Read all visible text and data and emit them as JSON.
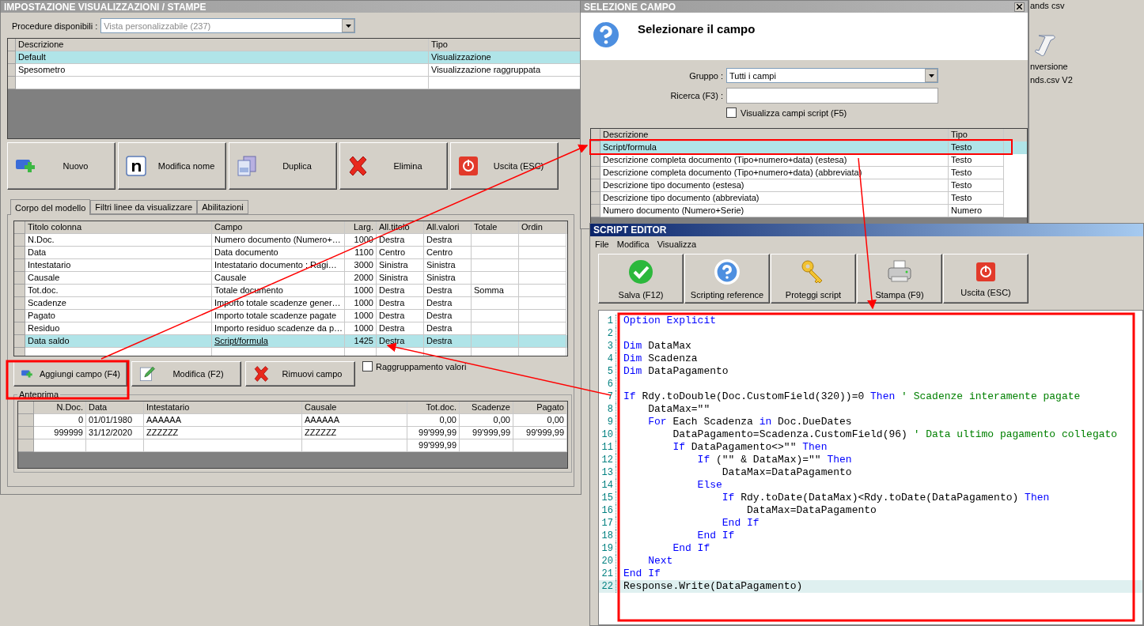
{
  "main_window": {
    "title": "IMPOSTAZIONE VISUALIZZAZIONI / STAMPE",
    "procedure": {
      "label": "Procedure disponibili :",
      "value": "Vista personalizzabile (237)",
      "disabled": true
    },
    "views_table": {
      "columns": [
        "Descrizione",
        "Tipo"
      ],
      "rows": [
        {
          "cells": [
            "Default",
            "Visualizzazione"
          ],
          "selected": true
        },
        {
          "cells": [
            "Spesometro",
            "Visualizzazione raggruppata"
          ],
          "selected": false
        }
      ]
    },
    "toolbar": [
      {
        "label": "Nuovo",
        "kind": "new"
      },
      {
        "label": "Modifica nome",
        "kind": "rename"
      },
      {
        "label": "Duplica",
        "kind": "duplicate"
      },
      {
        "label": "Elimina",
        "kind": "delete"
      },
      {
        "label": "Uscita (ESC)",
        "kind": "exit"
      }
    ],
    "tabs": [
      {
        "label": "Corpo del modello",
        "selected": true
      },
      {
        "label": "Filtri linee da visualizzare",
        "selected": false
      },
      {
        "label": "Abilitazioni",
        "selected": false
      }
    ],
    "fields_table": {
      "columns": [
        "Titolo colonna",
        "Campo",
        "Larg.",
        "All.titolo",
        "All.valori",
        "Totale",
        "Ordin"
      ],
      "rows": [
        {
          "cells": [
            "N.Doc.",
            "Numero documento (Numero+…",
            "1000",
            "Destra",
            "Destra",
            null,
            null
          ],
          "selected": false
        },
        {
          "cells": [
            "Data",
            "Data documento",
            "1100",
            "Centro",
            "Centro",
            null,
            null
          ],
          "selected": false
        },
        {
          "cells": [
            "Intestatario",
            "Intestatario documento : Ragi…",
            "3000",
            "Sinistra",
            "Sinistra",
            null,
            null
          ],
          "selected": false
        },
        {
          "cells": [
            "Causale",
            "Causale",
            "2000",
            "Sinistra",
            "Sinistra",
            null,
            null
          ],
          "selected": false
        },
        {
          "cells": [
            "Tot.doc.",
            "Totale documento",
            "1000",
            "Destra",
            "Destra",
            "Somma",
            null
          ],
          "selected": false
        },
        {
          "cells": [
            "Scadenze",
            "Importo totale scadenze gener…",
            "1000",
            "Destra",
            "Destra",
            null,
            null
          ],
          "selected": false
        },
        {
          "cells": [
            "Pagato",
            "Importo totale scadenze pagate",
            "1000",
            "Destra",
            "Destra",
            null,
            null
          ],
          "selected": false
        },
        {
          "cells": [
            "Residuo",
            "Importo residuo scadenze da p…",
            "1000",
            "Destra",
            "Destra",
            null,
            null
          ],
          "selected": false
        },
        {
          "cells": [
            "Data saldo",
            "Script/formula",
            "1425",
            "Destra",
            "Destra",
            null,
            null
          ],
          "selected": true
        }
      ]
    },
    "field_buttons": [
      {
        "label": "Aggiungi campo (F4)",
        "kind": "add"
      },
      {
        "label": "Modifica (F2)",
        "kind": "edit"
      },
      {
        "label": "Rimuovi campo",
        "kind": "delete"
      }
    ],
    "grouping": {
      "label": "Raggruppamento valori",
      "checked": false
    },
    "preview": {
      "title": "Anteprima",
      "columns": [
        "N.Doc.",
        "Data",
        "Intestatario",
        "Causale",
        "Tot.doc.",
        "Scadenze",
        "Pagato"
      ],
      "rows": [
        [
          "0",
          "01/01/1980",
          "AAAAAA",
          "AAAAAA",
          "0,00",
          "0,00",
          "0,00"
        ],
        [
          "999999",
          "31/12/2020",
          "ZZZZZZ",
          "ZZZZZZ",
          "99'999,99",
          "99'999,99",
          "99'999,99"
        ],
        [
          null,
          null,
          null,
          null,
          "99'999,99",
          null,
          null
        ]
      ]
    }
  },
  "field_dialog": {
    "title": "SELEZIONE CAMPO",
    "heading": "Selezionare il campo",
    "group": {
      "label": "Gruppo :",
      "value": "Tutti i campi"
    },
    "search": {
      "label": "Ricerca (F3) :"
    },
    "script_fields": {
      "label": "Visualizza campi script (F5)",
      "checked": false
    },
    "table": {
      "columns": [
        "Descrizione",
        "Tipo"
      ],
      "rows": [
        {
          "cells": [
            "Script/formula",
            "Testo"
          ],
          "selected": true
        },
        {
          "cells": [
            "Descrizione completa documento (Tipo+numero+data) (estesa)",
            "Testo"
          ],
          "selected": false
        },
        {
          "cells": [
            "Descrizione completa documento (Tipo+numero+data) (abbreviata)",
            "Testo"
          ],
          "selected": false
        },
        {
          "cells": [
            "Descrizione tipo documento (estesa)",
            "Testo"
          ],
          "selected": false
        },
        {
          "cells": [
            "Descrizione tipo documento (abbreviata)",
            "Testo"
          ],
          "selected": false
        },
        {
          "cells": [
            "Numero documento (Numero+Serie)",
            "Numero"
          ],
          "selected": false
        }
      ]
    }
  },
  "script_editor": {
    "title": "SCRIPT EDITOR",
    "menu": [
      "File",
      "Modifica",
      "Visualizza"
    ],
    "toolbar": [
      {
        "label": "Salva (F12)",
        "kind": "save"
      },
      {
        "label": "Scripting reference",
        "kind": "help"
      },
      {
        "label": "Proteggi script",
        "kind": "protect"
      },
      {
        "label": "Stampa (F9)",
        "kind": "print"
      },
      {
        "label": "Uscita (ESC)",
        "kind": "exit"
      }
    ],
    "lines": [
      {
        "number": "1",
        "tokens": [
          {
            "kind": "keyword",
            "text": "Option Explicit"
          }
        ],
        "current": false
      },
      {
        "number": "2",
        "current": false
      },
      {
        "number": "3",
        "tokens": [
          {
            "kind": "keyword",
            "text": "Dim"
          },
          {
            "kind": "plain",
            "text": " DataMax"
          }
        ],
        "current": false
      },
      {
        "number": "4",
        "tokens": [
          {
            "kind": "keyword",
            "text": "Dim"
          },
          {
            "kind": "plain",
            "text": " Scadenza"
          }
        ],
        "current": false
      },
      {
        "number": "5",
        "tokens": [
          {
            "kind": "keyword",
            "text": "Dim"
          },
          {
            "kind": "plain",
            "text": " DataPagamento"
          }
        ],
        "current": false
      },
      {
        "number": "6",
        "current": false
      },
      {
        "number": "7",
        "tokens": [
          {
            "kind": "keyword",
            "text": "If"
          },
          {
            "kind": "plain",
            "text": " Rdy.toDouble(Doc.CustomField(320))=0 "
          },
          {
            "kind": "keyword",
            "text": "Then"
          },
          {
            "kind": "comment",
            "text": " ' Scadenze interamente pagate"
          }
        ],
        "current": false
      },
      {
        "number": "8",
        "tokens": [
          {
            "kind": "plain",
            "text": "    DataMax=\"\""
          }
        ],
        "current": false
      },
      {
        "number": "9",
        "tokens": [
          {
            "kind": "keyword",
            "text": "    For"
          },
          {
            "kind": "plain",
            "text": " Each Scadenza "
          },
          {
            "kind": "keyword",
            "text": "in"
          },
          {
            "kind": "plain",
            "text": " Doc.DueDates"
          }
        ],
        "current": false
      },
      {
        "number": "10",
        "tokens": [
          {
            "kind": "plain",
            "text": "        DataPagamento=Scadenza.CustomField(96) "
          },
          {
            "kind": "comment",
            "text": "' Data ultimo pagamento collegato"
          }
        ],
        "current": false
      },
      {
        "number": "11",
        "tokens": [
          {
            "kind": "keyword",
            "text": "        If"
          },
          {
            "kind": "plain",
            "text": " DataPagamento<>\"\" "
          },
          {
            "kind": "keyword",
            "text": "Then"
          }
        ],
        "current": false
      },
      {
        "number": "12",
        "tokens": [
          {
            "kind": "keyword",
            "text": "            If"
          },
          {
            "kind": "plain",
            "text": " (\"\" & DataMax)=\"\" "
          },
          {
            "kind": "keyword",
            "text": "Then"
          }
        ],
        "current": false
      },
      {
        "number": "13",
        "tokens": [
          {
            "kind": "plain",
            "text": "                DataMax=DataPagamento"
          }
        ],
        "current": false
      },
      {
        "number": "14",
        "tokens": [
          {
            "kind": "keyword",
            "text": "            Else"
          }
        ],
        "current": false
      },
      {
        "number": "15",
        "tokens": [
          {
            "kind": "keyword",
            "text": "                If"
          },
          {
            "kind": "plain",
            "text": " Rdy.toDate(DataMax)<Rdy.toDate(DataPagamento) "
          },
          {
            "kind": "keyword",
            "text": "Then"
          }
        ],
        "current": false
      },
      {
        "number": "16",
        "tokens": [
          {
            "kind": "plain",
            "text": "                    DataMax=DataPagamento"
          }
        ],
        "current": false
      },
      {
        "number": "17",
        "tokens": [
          {
            "kind": "keyword",
            "text": "                End If"
          }
        ],
        "current": false
      },
      {
        "number": "18",
        "tokens": [
          {
            "kind": "keyword",
            "text": "            End If"
          }
        ],
        "current": false
      },
      {
        "number": "19",
        "tokens": [
          {
            "kind": "keyword",
            "text": "        End If"
          }
        ],
        "current": false
      },
      {
        "number": "20",
        "tokens": [
          {
            "kind": "keyword",
            "text": "    Next"
          }
        ],
        "current": false
      },
      {
        "number": "21",
        "tokens": [
          {
            "kind": "keyword",
            "text": "End If"
          }
        ],
        "current": false
      },
      {
        "number": "22",
        "tokens": [
          {
            "kind": "plain",
            "text": "Response.Write(DataPagamento)"
          }
        ],
        "current": true
      }
    ]
  },
  "desktop_icons": [
    {
      "label_lines": [
        "ands csv"
      ]
    },
    {
      "label_lines": [
        "nversione",
        "nds.csv V2"
      ],
      "kind": "script"
    }
  ]
}
